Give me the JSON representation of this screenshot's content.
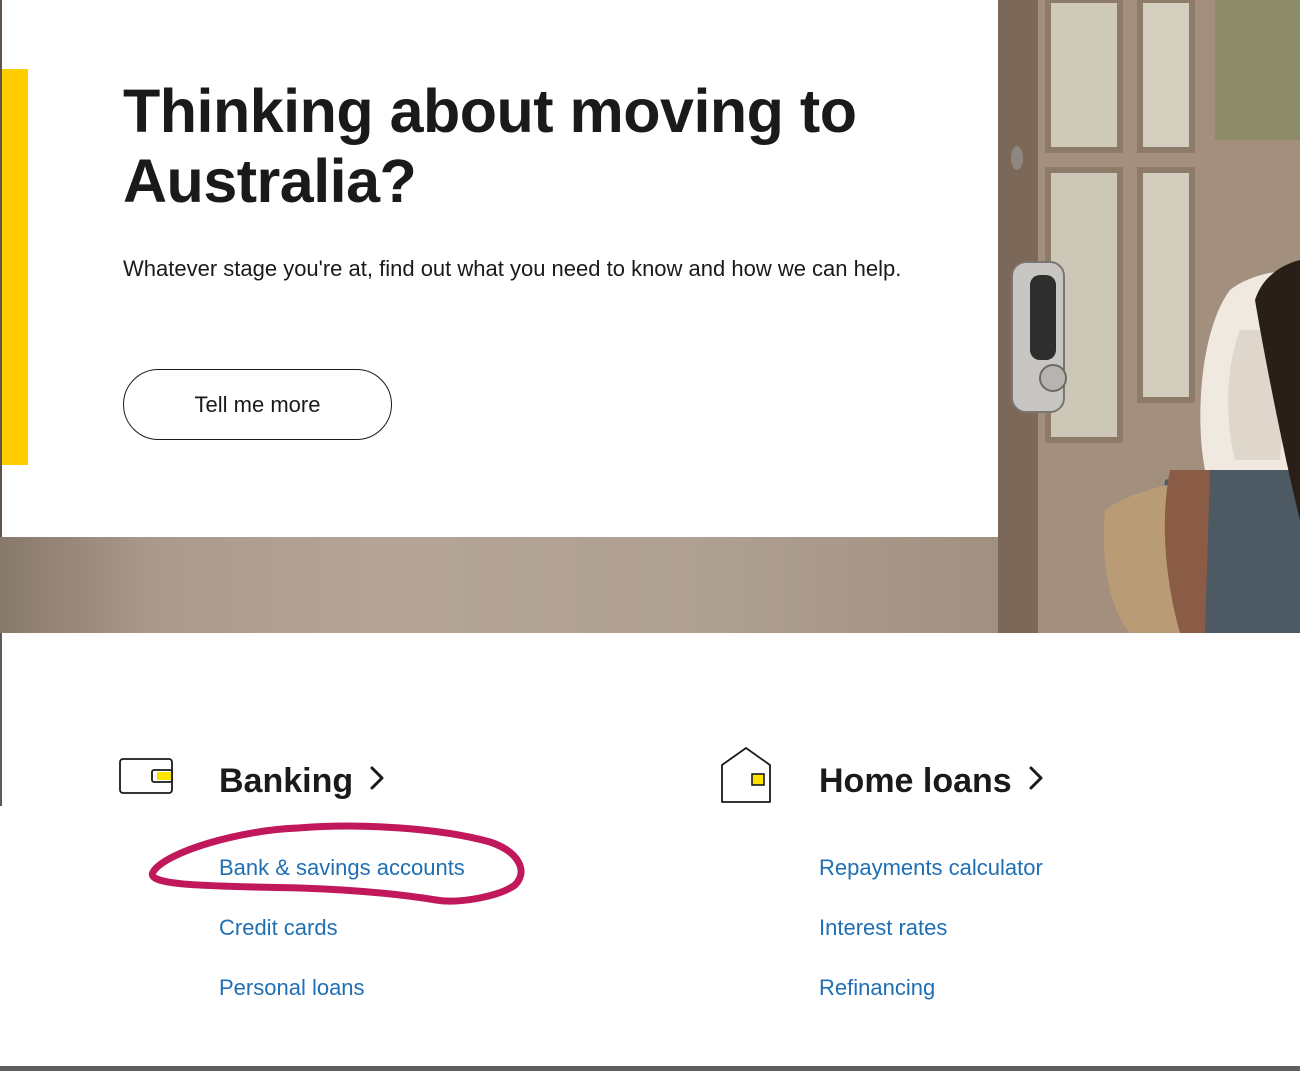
{
  "hero": {
    "title": "Thinking about moving to Australia?",
    "subtitle": "Whatever stage you're at, find out what you need to know and how we can help.",
    "cta_label": "Tell me more"
  },
  "categories": [
    {
      "title": "Banking",
      "icon": "wallet-icon",
      "links": [
        "Bank & savings accounts",
        "Credit cards",
        "Personal loans"
      ]
    },
    {
      "title": "Home loans",
      "icon": "house-icon",
      "links": [
        "Repayments calculator",
        "Interest rates",
        "Refinancing"
      ]
    }
  ],
  "colors": {
    "accent": "#ffcc00",
    "link": "#1f6fb4",
    "annotation": "#c0185a",
    "text": "#1a1a1a"
  }
}
